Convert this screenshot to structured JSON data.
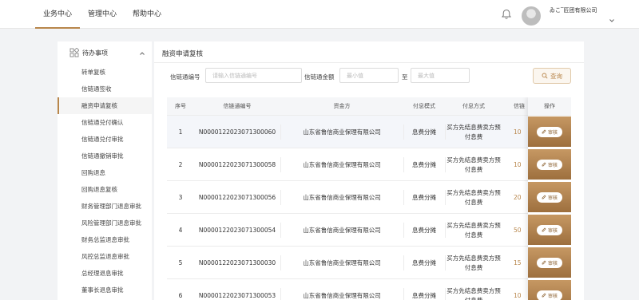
{
  "nav": {
    "items": [
      "业务中心",
      "管理中心",
      "帮助中心"
    ],
    "active": 0
  },
  "user": {
    "company": "ゐこ‾匠团有限公司"
  },
  "sidebar": {
    "group_label": "待办事项",
    "items": [
      "转单复核",
      "信链通签收",
      "融资申请复核",
      "信链通兑付确认",
      "信链通兑付审批",
      "信链通撤销审批",
      "回购退息",
      "回购退息复核",
      "财务管理部门退息审批",
      "风险管理部门退息审批",
      "财务总监退息审批",
      "风控总监退息审批",
      "总经理退息审批",
      "董事长退息审批"
    ],
    "active_index": 2
  },
  "main": {
    "title": "融资申请复核",
    "filters": {
      "code_label": "信链通编号",
      "code_placeholder": "请输入信链通编号",
      "amount_label": "信链通金额",
      "min_placeholder": "最小值",
      "to_label": "至",
      "max_placeholder": "最大值",
      "query_label": "查询"
    },
    "table": {
      "headers": [
        "序号",
        "信链通编号",
        "资金方",
        "付息模式",
        "付息方式",
        "信链"
      ],
      "action_header": "操作",
      "action_label": "审核",
      "rows": [
        {
          "no": "1",
          "code": "N0000122023071300060",
          "funder": "山东省鲁信商业保理有限公司",
          "mode": "息费分摊",
          "method": "买方先结息费卖方预付息费",
          "amount": "10"
        },
        {
          "no": "2",
          "code": "N0000122023071300058",
          "funder": "山东省鲁信商业保理有限公司",
          "mode": "息费分摊",
          "method": "买方先结息费卖方预付息费",
          "amount": "10"
        },
        {
          "no": "3",
          "code": "N0000122023071300056",
          "funder": "山东省鲁信商业保理有限公司",
          "mode": "息费分摊",
          "method": "买方先结息费卖方预付息费",
          "amount": "20"
        },
        {
          "no": "4",
          "code": "N0000122023071300054",
          "funder": "山东省鲁信商业保理有限公司",
          "mode": "息费分摊",
          "method": "买方先结息费卖方预付息费",
          "amount": "50"
        },
        {
          "no": "5",
          "code": "N0000122023071300030",
          "funder": "山东省鲁信商业保理有限公司",
          "mode": "息费分摊",
          "method": "买方先结息费卖方预付息费",
          "amount": "15"
        },
        {
          "no": "6",
          "code": "N0000122023071300053",
          "funder": "山东省鲁信商业保理有限公司",
          "mode": "息费分摊",
          "method": "买方先结息费卖方预付息费",
          "amount": "10"
        }
      ]
    }
  }
}
